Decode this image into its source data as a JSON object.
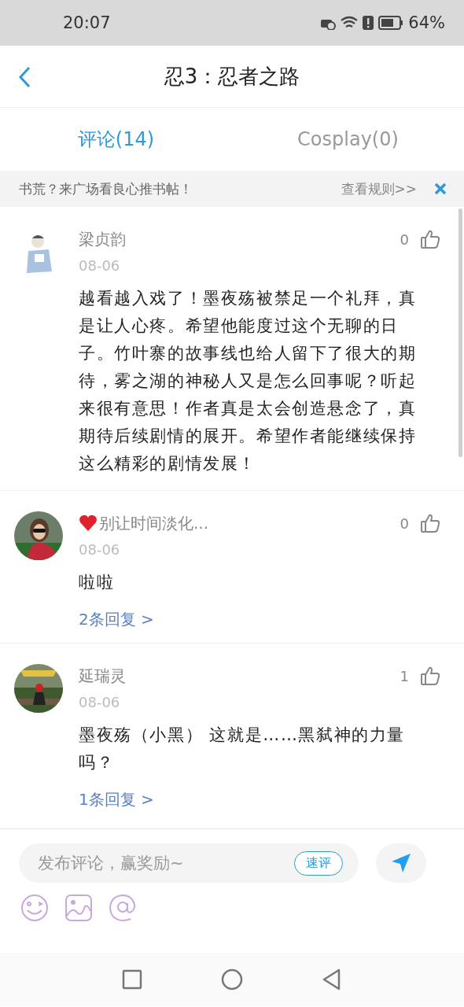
{
  "status_bar": {
    "time": "20:07",
    "battery": "64%"
  },
  "header": {
    "title": "忍3：忍者之路"
  },
  "tabs": [
    {
      "label": "评论(14)",
      "selected": true
    },
    {
      "label": "Cosplay(0)",
      "selected": false
    }
  ],
  "banner": {
    "text": "书荒？来广场看良心推书帖！",
    "link": "查看规则>>"
  },
  "comments": [
    {
      "name": "梁贞韵",
      "heart": false,
      "date": "08-06",
      "likes": "0",
      "text": "越看越入戏了！墨夜殇被禁足一个礼拜，真是让人心疼。希望他能度过这个无聊的日子。竹叶寨的故事线也给人留下了很大的期待，雾之湖的神秘人又是怎么回事呢？听起来很有意思！作者真是太会创造悬念了，真期待后续剧情的展开。希望作者能继续保持这么精彩的剧情发展！"
    },
    {
      "name": "别让时间淡化...",
      "heart": true,
      "date": "08-06",
      "likes": "0",
      "text": "啦啦",
      "replies": "2条回复 >"
    },
    {
      "name": "延瑞灵",
      "heart": false,
      "date": "08-06",
      "likes": "1",
      "text": "墨夜殇（小黑） 这就是……黑弑神的力量吗？",
      "replies": "1条回复 >"
    }
  ],
  "composer": {
    "placeholder": "发布评论，赢奖励~",
    "quick_button": "速评"
  }
}
